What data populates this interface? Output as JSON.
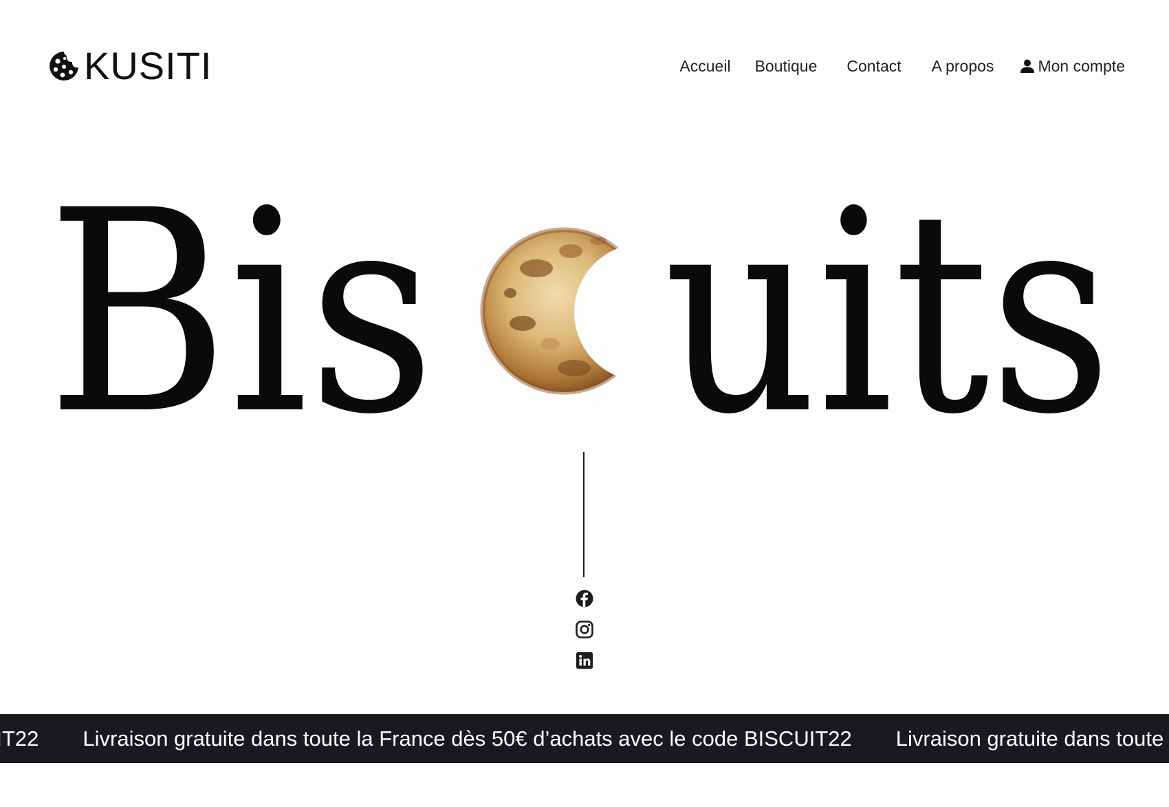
{
  "brand": {
    "name": "KUSITI",
    "logo_icon": "cookie-icon"
  },
  "nav": {
    "accueil": "Accueil",
    "boutique": "Boutique",
    "contact": "Contact",
    "apropos": "A propos",
    "account": {
      "label": "Mon compte",
      "icon": "user-icon"
    }
  },
  "hero": {
    "word_left": "Bis",
    "word_right": "uits",
    "cookie_icon": "bitten-cookie-image"
  },
  "social": [
    {
      "name": "facebook-icon"
    },
    {
      "name": "instagram-icon"
    },
    {
      "name": "linkedin-icon"
    }
  ],
  "banner": {
    "text": "Livraison gratuite dans toute la France dès 50€ d’achats avec le code BISCUIT22"
  },
  "colors": {
    "background": "#fefdfe",
    "text": "#111111",
    "banner_bg": "#1a191e",
    "banner_text": "#ffffff"
  }
}
